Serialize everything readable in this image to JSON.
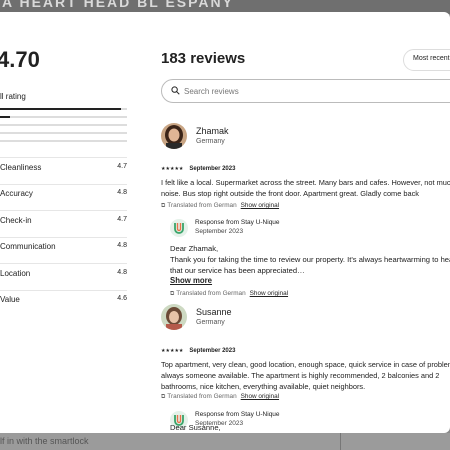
{
  "backdrop": {
    "top_text": "A HEART HEAD BL ESPANY",
    "bottom_text": "lf in with the smartlock"
  },
  "summary": {
    "overall_score": "4.70",
    "overall_label": "ll rating",
    "rating_distribution": [
      0.95,
      0.08,
      0.0,
      0.0,
      0.0
    ],
    "categories": [
      {
        "label": "Cleanliness",
        "value": "4.7"
      },
      {
        "label": "Accuracy",
        "value": "4.8"
      },
      {
        "label": "Check-in",
        "value": "4.7"
      },
      {
        "label": "Communication",
        "value": "4.8"
      },
      {
        "label": "Location",
        "value": "4.8"
      },
      {
        "label": "Value",
        "value": "4.6"
      }
    ]
  },
  "header": {
    "reviews_count": "183 reviews",
    "sort_label": "Most recent"
  },
  "search": {
    "placeholder": "Search reviews",
    "icon": "search-icon"
  },
  "reviews": [
    {
      "name": "Zhamak",
      "country": "Germany",
      "stars": "★★★★★",
      "date": "September 2023",
      "text": "I felt like a local. Supermarket across the street. Many bars and cafes. However, not much noise. Bus stop right outside the front door. Apartment great. Gladly come back",
      "translated_label": "Translated from German",
      "show_original": "Show original",
      "response": {
        "title": "Response from Stay U-Nique",
        "date": "September 2023",
        "text": "Dear Zhamak,\nThank you for taking the time to review our property. It's always heartwarming to hear that our service has been appreciated…",
        "show_more": "Show more",
        "translated_label": "Translated from German",
        "show_original": "Show original"
      }
    },
    {
      "name": "Susanne",
      "country": "Germany",
      "stars": "★★★★★",
      "date": "September 2023",
      "text": "Top apartment, very clean, good location, enough space, quick service in case of problems, always someone available. The apartment is highly recommended, 2 balconies and 2 bathrooms, nice kitchen, everything available, quiet neighbors.",
      "translated_label": "Translated from German",
      "show_original": "Show original",
      "response": {
        "title": "Response from Stay U-Nique",
        "date": "September 2023",
        "text": "Dear Susanne,"
      }
    }
  ]
}
